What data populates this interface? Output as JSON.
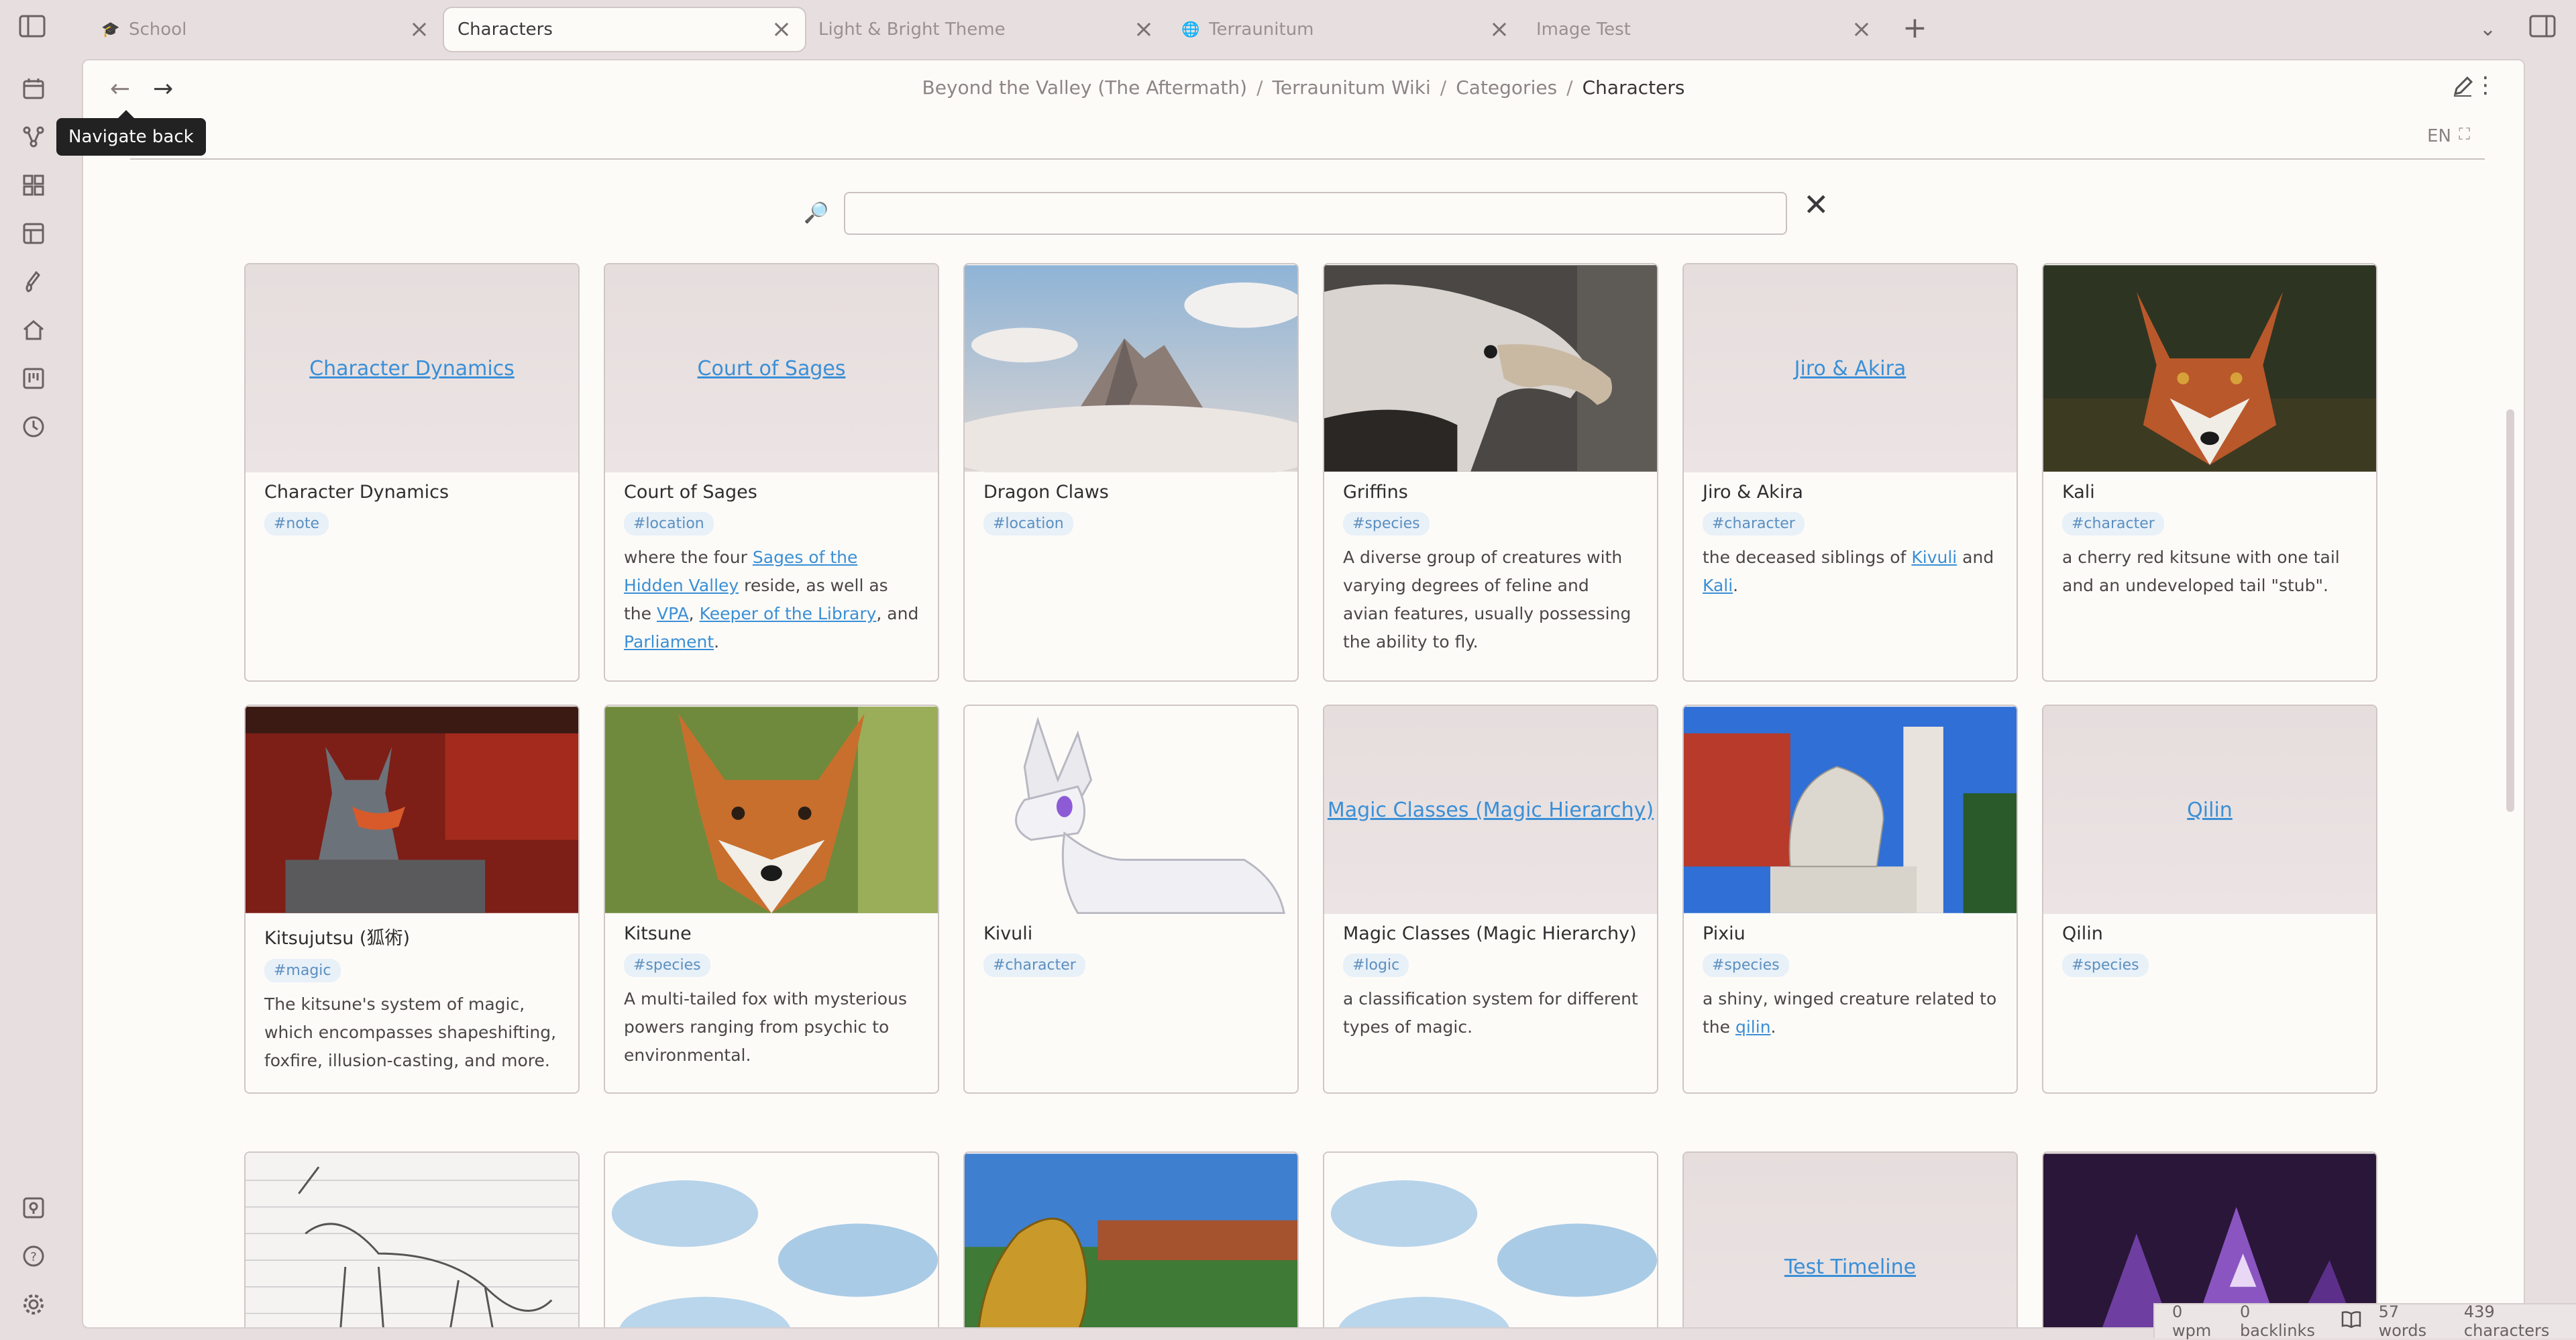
{
  "tabs": [
    {
      "label": "School",
      "icon": "graduation-cap-icon"
    },
    {
      "label": "Characters",
      "active": true
    },
    {
      "label": "Light & Bright Theme"
    },
    {
      "label": "Terraunitum",
      "icon": "globe-icon"
    },
    {
      "label": "Image Test"
    }
  ],
  "breadcrumb": {
    "items": [
      "Beyond the Valley (The Aftermath)",
      "Terraunitum Wiki",
      "Categories"
    ],
    "current": "Characters",
    "separator": "/"
  },
  "tooltip": "Navigate back",
  "lang": "EN",
  "search": {
    "value": "",
    "placeholder": ""
  },
  "cards": [
    {
      "title": "Character Dynamics",
      "tag": "#note",
      "thumb_link": "Character Dynamics",
      "desc": ""
    },
    {
      "title": "Court of Sages",
      "tag": "#location",
      "thumb_link": "Court of Sages",
      "desc_parts": [
        "where the four ",
        "Sages of the Hidden Valley",
        " reside, as well as the ",
        "VPA",
        ", ",
        "Keeper of the Library",
        ", and ",
        "Parliament",
        "."
      ]
    },
    {
      "title": "Dragon Claws",
      "tag": "#location",
      "image": "mountain-clouds"
    },
    {
      "title": "Griffins",
      "tag": "#species",
      "image": "vulture",
      "desc": "A diverse group of creatures with varying degrees of feline and avian features, usually possessing the ability to fly."
    },
    {
      "title": "Jiro & Akira",
      "tag": "#character",
      "thumb_link": "Jiro & Akira",
      "desc_parts": [
        "the deceased siblings of ",
        "Kivuli",
        " and ",
        "Kali",
        "."
      ]
    },
    {
      "title": "Kali",
      "tag": "#character",
      "image": "red-fox",
      "desc": "a cherry red kitsune with one tail and an undeveloped tail \"stub\"."
    },
    {
      "title": "Kitsujutsu (狐術)",
      "tag": "#magic",
      "image": "fox-statue",
      "desc": "The kitsune's system of magic, which encompasses shapeshifting, foxfire, illusion-casting, and more."
    },
    {
      "title": "Kitsune",
      "tag": "#species",
      "image": "fox-face",
      "desc": "A multi-tailed fox with mysterious powers ranging from psychic to environmental."
    },
    {
      "title": "Kivuli",
      "tag": "#character",
      "image": "white-fox-cartoon"
    },
    {
      "title": "Magic Classes (Magic Hierarchy)",
      "tag": "#logic",
      "thumb_link": "Magic Classes (Magic Hierarchy)",
      "desc": "a classification system for different types of magic."
    },
    {
      "title": "Pixiu",
      "tag": "#species",
      "image": "stone-lion",
      "desc_parts": [
        "a shiny, winged creature related to the ",
        "qilin",
        "."
      ]
    },
    {
      "title": "Qilin",
      "tag": "#species",
      "thumb_link": "Qilin"
    },
    {
      "image": "sketch"
    },
    {
      "image": "clouds"
    },
    {
      "image": "golden-dragon"
    },
    {
      "image": "clouds"
    },
    {
      "thumb_link": "Test Timeline"
    },
    {
      "image": "amethyst"
    }
  ],
  "status": {
    "wpm": "0 wpm",
    "backlinks": "0 backlinks",
    "words": "57 words",
    "characters": "439 characters"
  },
  "colors": {
    "accent": "#3a8fd6",
    "tag_bg": "#e8f0f8",
    "tag_text": "#5b8fbf",
    "frame": "#e7dfdf",
    "page": "#fdfbf8"
  }
}
